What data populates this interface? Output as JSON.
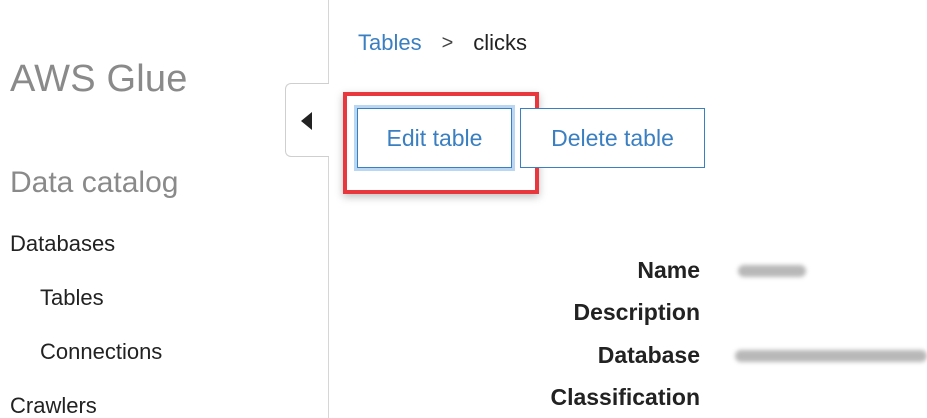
{
  "sidebar": {
    "service_title": "AWS Glue",
    "section_title": "Data catalog",
    "items": [
      {
        "label": "Databases"
      },
      {
        "label": "Tables"
      },
      {
        "label": "Connections"
      },
      {
        "label": "Crawlers"
      }
    ]
  },
  "breadcrumb": {
    "parent": "Tables",
    "separator": ">",
    "current": "clicks"
  },
  "actions": {
    "edit_label": "Edit table",
    "delete_label": "Delete table"
  },
  "details": {
    "labels": [
      "Name",
      "Description",
      "Database",
      "Classification"
    ]
  },
  "colors": {
    "link": "#3a7fc1",
    "highlight": "#e8383d",
    "muted_title": "#8a8a8a"
  },
  "icons": {
    "collapse": "caret-left-icon"
  }
}
